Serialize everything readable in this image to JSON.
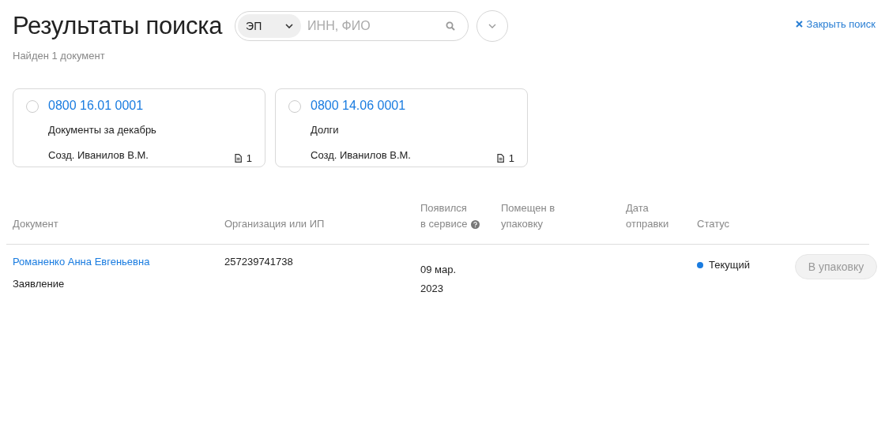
{
  "header": {
    "title": "Результаты поиска",
    "subtitle": "Найден 1 документ",
    "search": {
      "filter": "ЭП",
      "placeholder": "ИНН, ФИО"
    },
    "close": "Закрыть поиск"
  },
  "cards": [
    {
      "number": "0800 16.01 0001",
      "name": "Документы за декабрь",
      "author": "Созд. Иванилов В.М.",
      "count": "1",
      "selected": false
    },
    {
      "number": "0800 14.06 0001",
      "name": "Долги",
      "author": "Созд. Иванилов В.М.",
      "count": "1",
      "selected": false
    }
  ],
  "table": {
    "columns": [
      "Документ",
      "Организация или ИП",
      "Появился в сервисе",
      "Помещен в упаковку",
      "Дата отправки",
      "Статус"
    ],
    "rows": [
      {
        "document": "Романенко Анна Евгеньевна",
        "type": "Заявление",
        "organization": "257239741738",
        "appeared": "09 мар. 2023",
        "status": "Текущий",
        "color": "#1a7ce0",
        "action": {
          "label": "В упаковку",
          "disabled": true
        }
      }
    ]
  }
}
